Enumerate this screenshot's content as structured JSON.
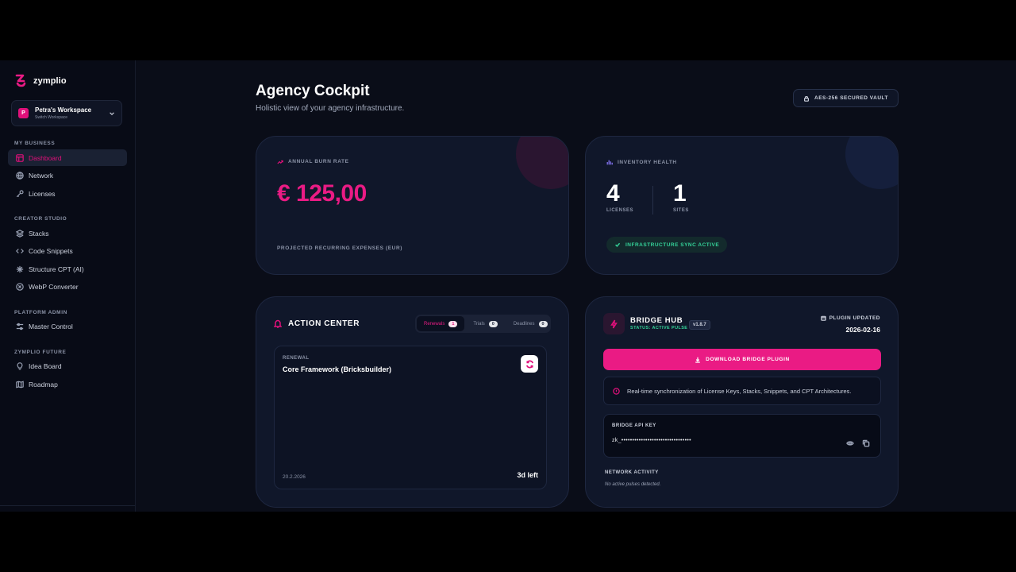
{
  "brand": {
    "name": "zymplio"
  },
  "workspace": {
    "avatar_letter": "P",
    "name": "Petra's Workspace",
    "sub": "Switch Workspace"
  },
  "sidebar": {
    "sections": [
      {
        "label": "MY BUSINESS",
        "items": [
          {
            "label": "Dashboard",
            "icon": "layout-icon",
            "active": true
          },
          {
            "label": "Network",
            "icon": "globe-icon"
          },
          {
            "label": "Licenses",
            "icon": "key-icon"
          }
        ]
      },
      {
        "label": "CREATOR STUDIO",
        "items": [
          {
            "label": "Stacks",
            "icon": "layers-icon"
          },
          {
            "label": "Code Snippets",
            "icon": "code-icon"
          },
          {
            "label": "Structure CPT (AI)",
            "icon": "sparkle-icon"
          },
          {
            "label": "WebP Converter",
            "icon": "image-icon"
          }
        ]
      },
      {
        "label": "PLATFORM ADMIN",
        "items": [
          {
            "label": "Master Control",
            "icon": "sliders-icon"
          }
        ]
      },
      {
        "label": "ZYMPLIO FUTURE",
        "items": [
          {
            "label": "Idea Board",
            "icon": "lightbulb-icon"
          },
          {
            "label": "Roadmap",
            "icon": "map-icon"
          }
        ]
      }
    ]
  },
  "page": {
    "title": "Agency Cockpit",
    "subtitle": "Holistic view of your agency infrastructure."
  },
  "vault": {
    "label": "AES-256 SECURED VAULT"
  },
  "burn": {
    "label": "ANNUAL BURN RATE",
    "value": "€ 125,00",
    "foot": "PROJECTED RECURRING EXPENSES (EUR)",
    "accent": "#ea1b84"
  },
  "inventory": {
    "label": "INVENTORY HEALTH",
    "licenses": {
      "value": "4",
      "label": "LICENSES"
    },
    "sites": {
      "value": "1",
      "label": "SITES"
    },
    "sync": "INFRASTRUCTURE SYNC ACTIVE"
  },
  "action": {
    "title": "ACTION CENTER",
    "tabs": [
      {
        "label": "Renewals",
        "count": "1",
        "active": true
      },
      {
        "label": "Trials",
        "count": "0"
      },
      {
        "label": "Deadlines",
        "count": "0"
      }
    ],
    "item": {
      "type": "RENEWAL",
      "name": "Core Framework (Bricksbuilder)",
      "date": "20.2.2026",
      "remaining": "3d left"
    }
  },
  "bridge": {
    "title": "BRIDGE HUB",
    "status": "STATUS: ACTIVE PULSE",
    "version": "v1.8.7",
    "updated_label": "PLUGIN UPDATED",
    "updated_date": "2026-02-16",
    "download": "DOWNLOAD BRIDGE PLUGIN",
    "info": "Real-time synchronization of License Keys, Stacks, Snippets, and CPT Architectures.",
    "api_label": "BRIDGE API KEY",
    "api_value": "zk_••••••••••••••••••••••••••••••••",
    "network_label": "NETWORK ACTIVITY",
    "network_empty": "No active pulses detected."
  }
}
